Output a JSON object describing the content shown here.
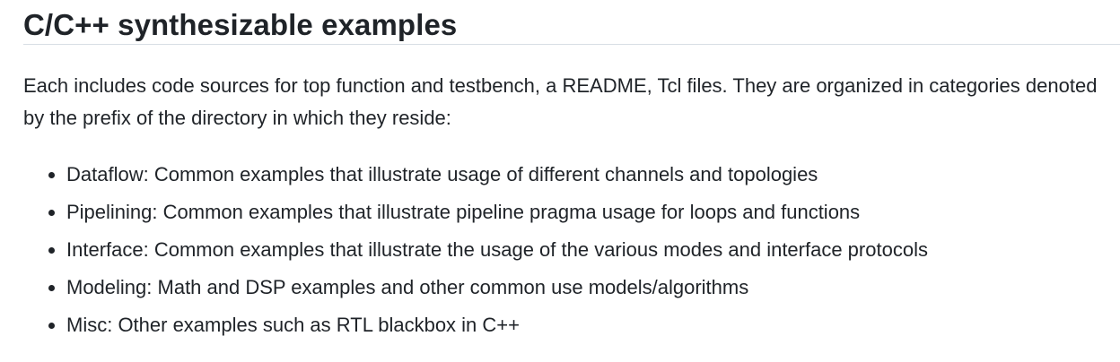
{
  "section": {
    "title": "C/C++ synthesizable examples",
    "intro": "Each includes code sources for top function and testbench, a README, Tcl files. They are organized in categories denoted by the prefix of the directory in which they reside:"
  },
  "categories": [
    "Dataflow: Common examples that illustrate usage of different channels and topologies",
    "Pipelining: Common examples that illustrate pipeline pragma usage for loops and functions",
    "Interface: Common examples that illustrate the usage of the various modes and interface protocols",
    "Modeling: Math and DSP examples and other common use models/algorithms",
    "Misc: Other examples such as RTL blackbox in C++"
  ]
}
